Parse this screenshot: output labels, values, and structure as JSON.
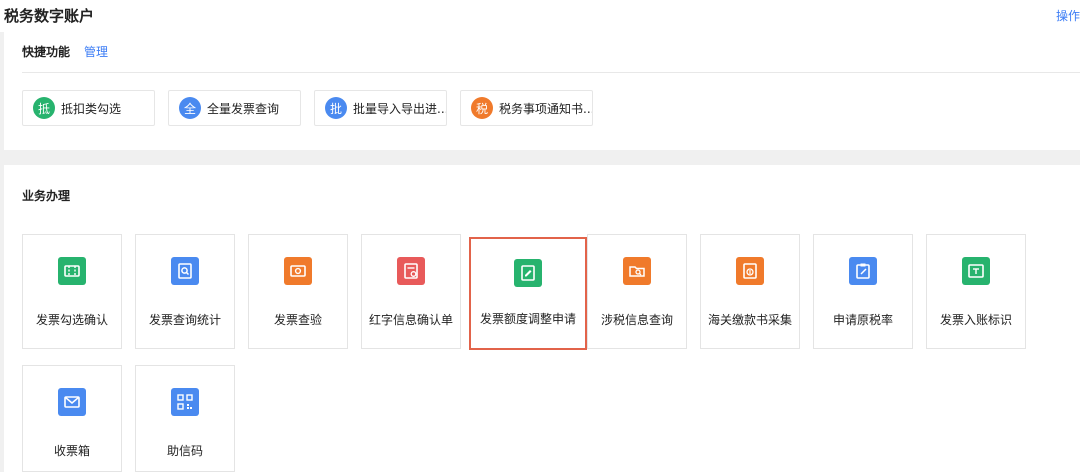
{
  "header": {
    "title": "税务数字账户",
    "action": "操作"
  },
  "quick": {
    "title": "快捷功能",
    "manage": "管理",
    "items": [
      {
        "icon": "抵",
        "label": "抵扣类勾选",
        "color": "#27b36e"
      },
      {
        "icon": "全",
        "label": "全量发票查询",
        "color": "#4a8af0"
      },
      {
        "icon": "批",
        "label": "批量导入导出进...",
        "color": "#4a8af0"
      },
      {
        "icon": "税",
        "label": "税务事项通知书...",
        "color": "#f07a2b"
      }
    ]
  },
  "business": {
    "title": "业务办理",
    "items": [
      {
        "label": "发票勾选确认",
        "icon": "ticket-icon",
        "color": "#27b36e"
      },
      {
        "label": "发票查询统计",
        "icon": "search-document-icon",
        "color": "#4a8af0"
      },
      {
        "label": "发票查验",
        "icon": "ticket-check-icon",
        "color": "#f07a2b"
      },
      {
        "label": "红字信息确认单",
        "icon": "red-letter-form-icon",
        "color": "#e85a5a"
      },
      {
        "label": "发票额度调整申请",
        "icon": "quota-adjust-icon",
        "color": "#27b36e",
        "selected": true
      },
      {
        "label": "涉税信息查询",
        "icon": "folder-search-icon",
        "color": "#f07a2b"
      },
      {
        "label": "海关缴款书采集",
        "icon": "customs-payment-icon",
        "color": "#f07a2b"
      },
      {
        "label": "申请原税率",
        "icon": "clipboard-edit-icon",
        "color": "#4a8af0"
      },
      {
        "label": "发票入账标识",
        "icon": "ledger-icon",
        "color": "#27b36e"
      },
      {
        "label": "收票箱",
        "icon": "mailbox-icon",
        "color": "#4a8af0"
      },
      {
        "label": "助信码",
        "icon": "qr-code-icon",
        "color": "#4a8af0"
      }
    ]
  }
}
